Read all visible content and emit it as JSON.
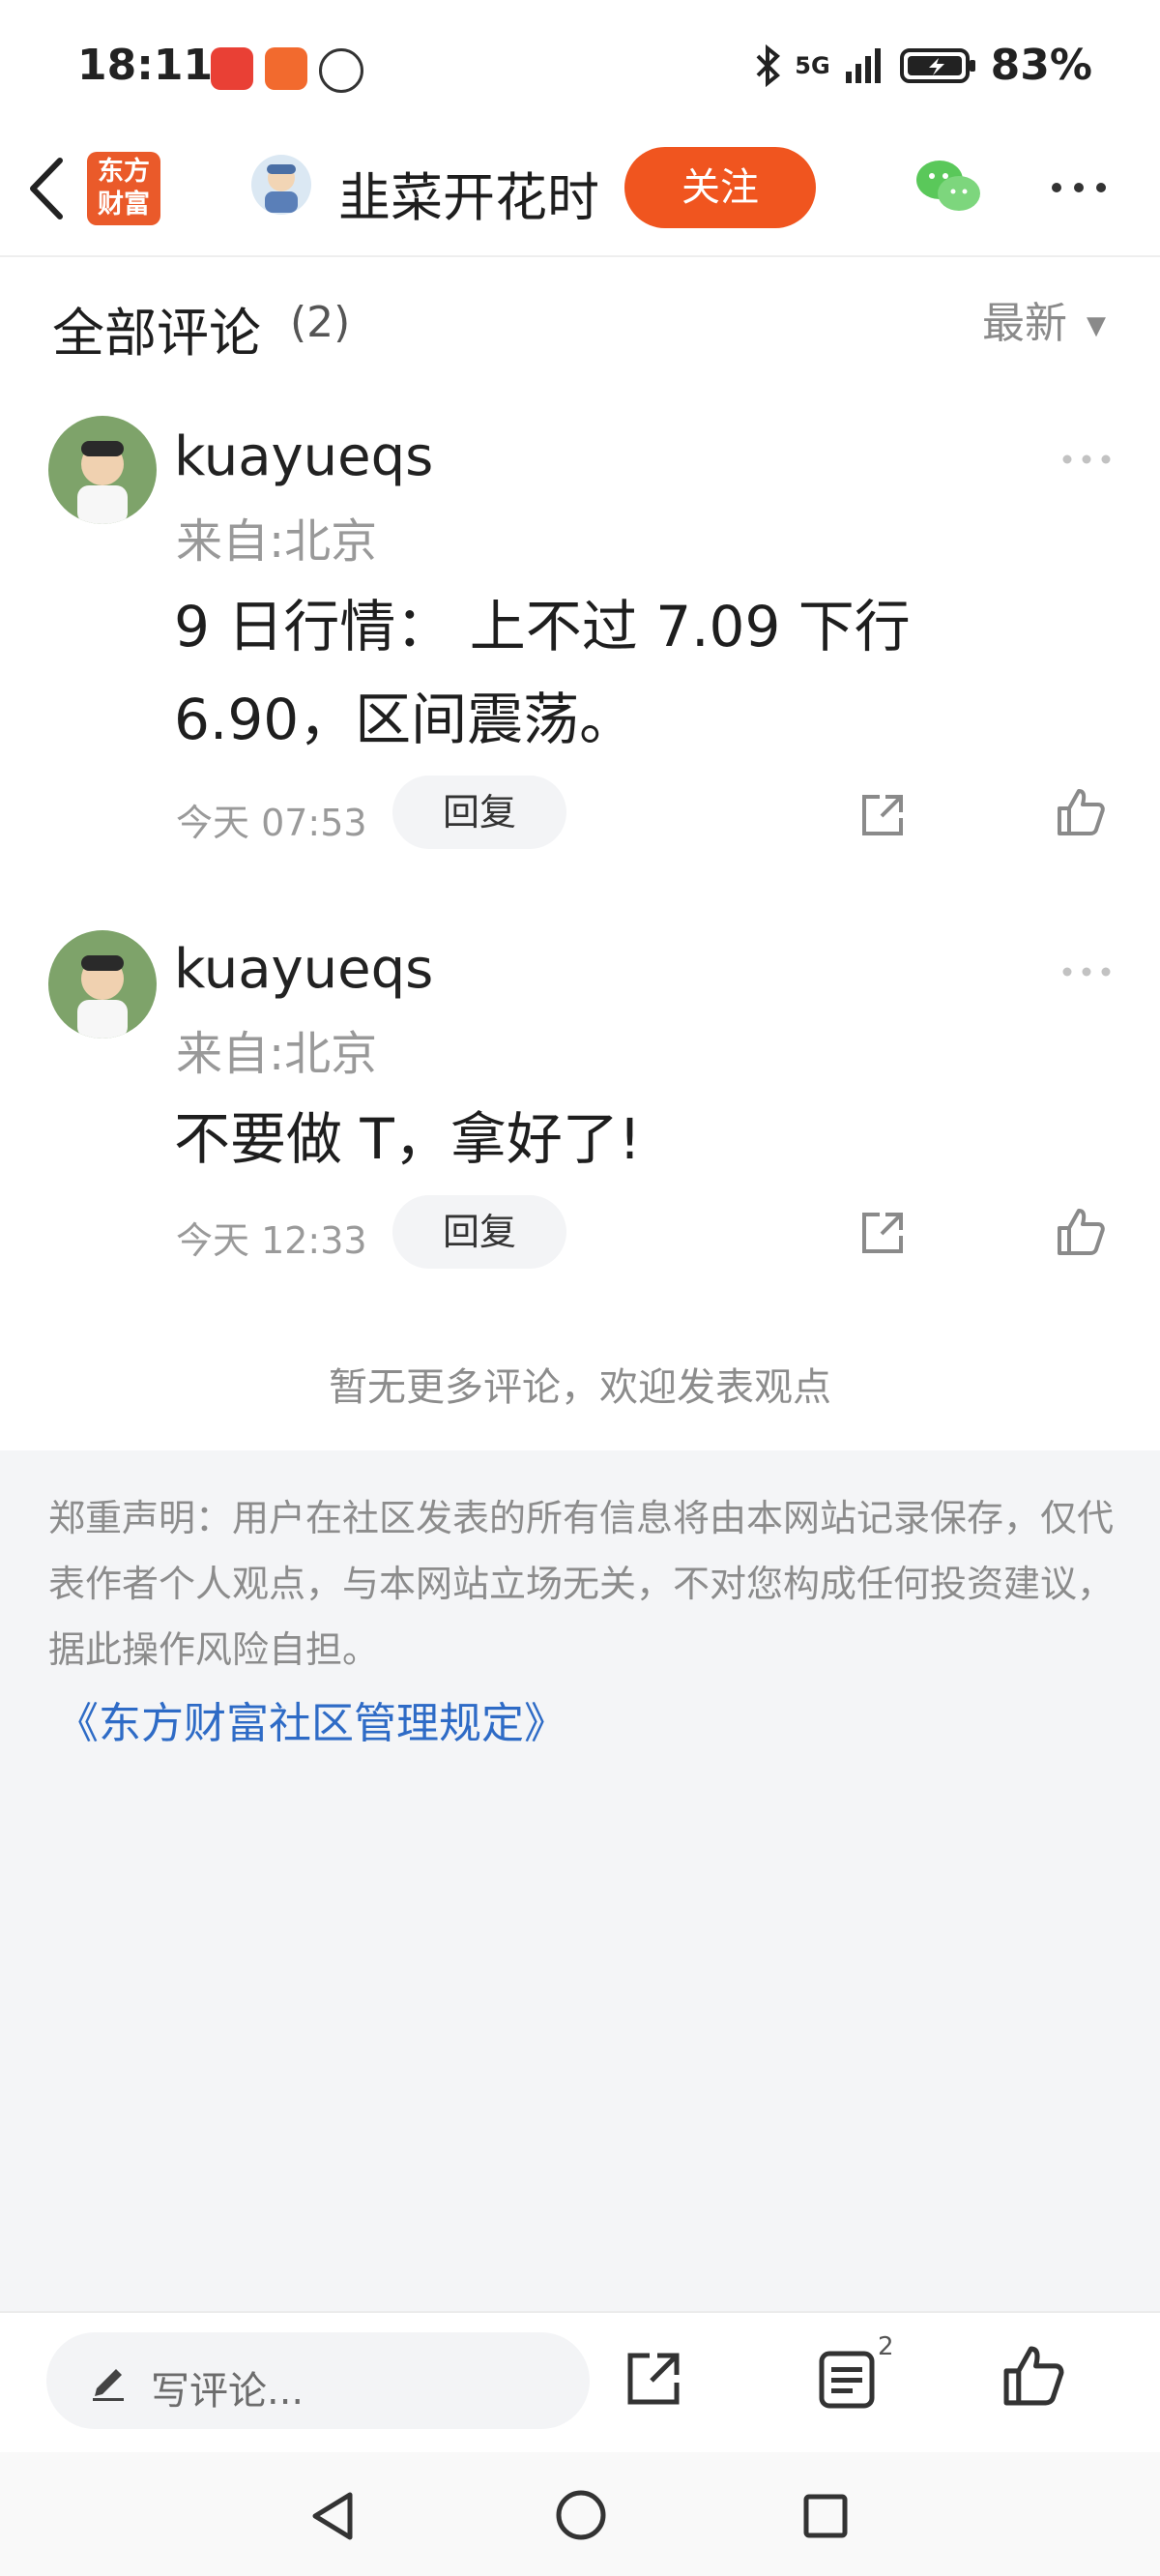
{
  "status_bar": {
    "time": "18:11",
    "network": "5G",
    "battery": "83%"
  },
  "header": {
    "logo_text": "东方\n财富",
    "title": "韭菜开花时",
    "follow_label": "关注"
  },
  "comments_section": {
    "title": "全部评论",
    "count": "(2)",
    "sort_label": "最新"
  },
  "comments": [
    {
      "name": "kuayueqs",
      "from": "来自:北京",
      "text": "9 日行情： 上不过 7.09 下行 6.90，区间震荡。",
      "time": "今天 07:53",
      "reply_label": "回复"
    },
    {
      "name": "kuayueqs",
      "from": "来自:北京",
      "text": "不要做 T，拿好了!",
      "time": "今天 12:33",
      "reply_label": "回复"
    }
  ],
  "no_more_text": "暂无更多评论，欢迎发表观点",
  "disclaimer": "郑重声明：用户在社区发表的所有信息将由本网站记录保存，仅代表作者个人观点，与本网站立场无关，不对您构成任何投资建议，据此操作风险自担。",
  "rules_link": "《东方财富社区管理规定》",
  "bottom_bar": {
    "comment_placeholder": "写评论...",
    "list_badge": "2"
  },
  "colors": {
    "accent": "#f0551f",
    "link": "#2e6bc6",
    "muted": "#8c8c8c"
  }
}
